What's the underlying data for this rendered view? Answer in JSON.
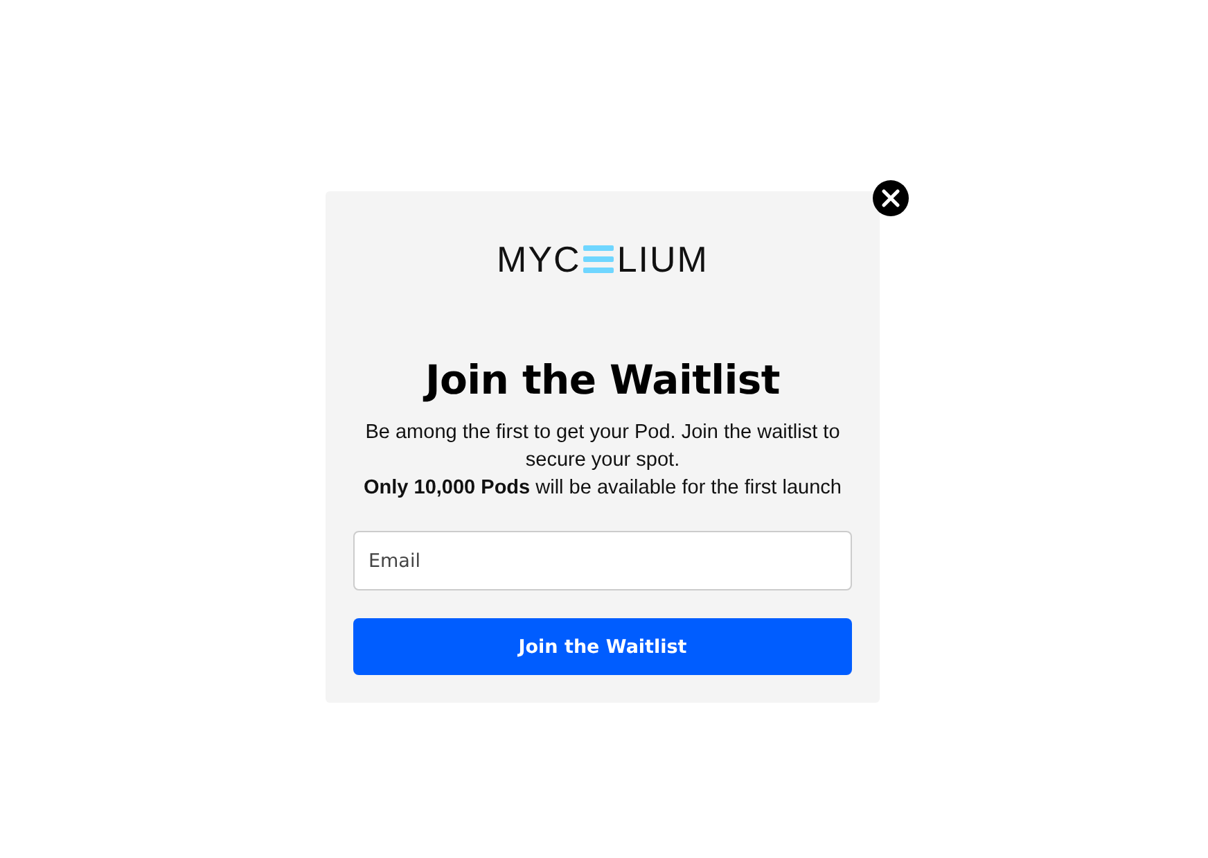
{
  "logo": {
    "left": "MYC",
    "right": "LIUM"
  },
  "title": "Join the Waitlist",
  "description": [
    "Be among the first to get your Pod. Join the waitlist to secure your spot.",
    "**Only 10,000 Pods** will be available for the first launch"
  ],
  "email_field": {
    "placeholder": "Email"
  },
  "submit_button": "Join the Waitlist"
}
